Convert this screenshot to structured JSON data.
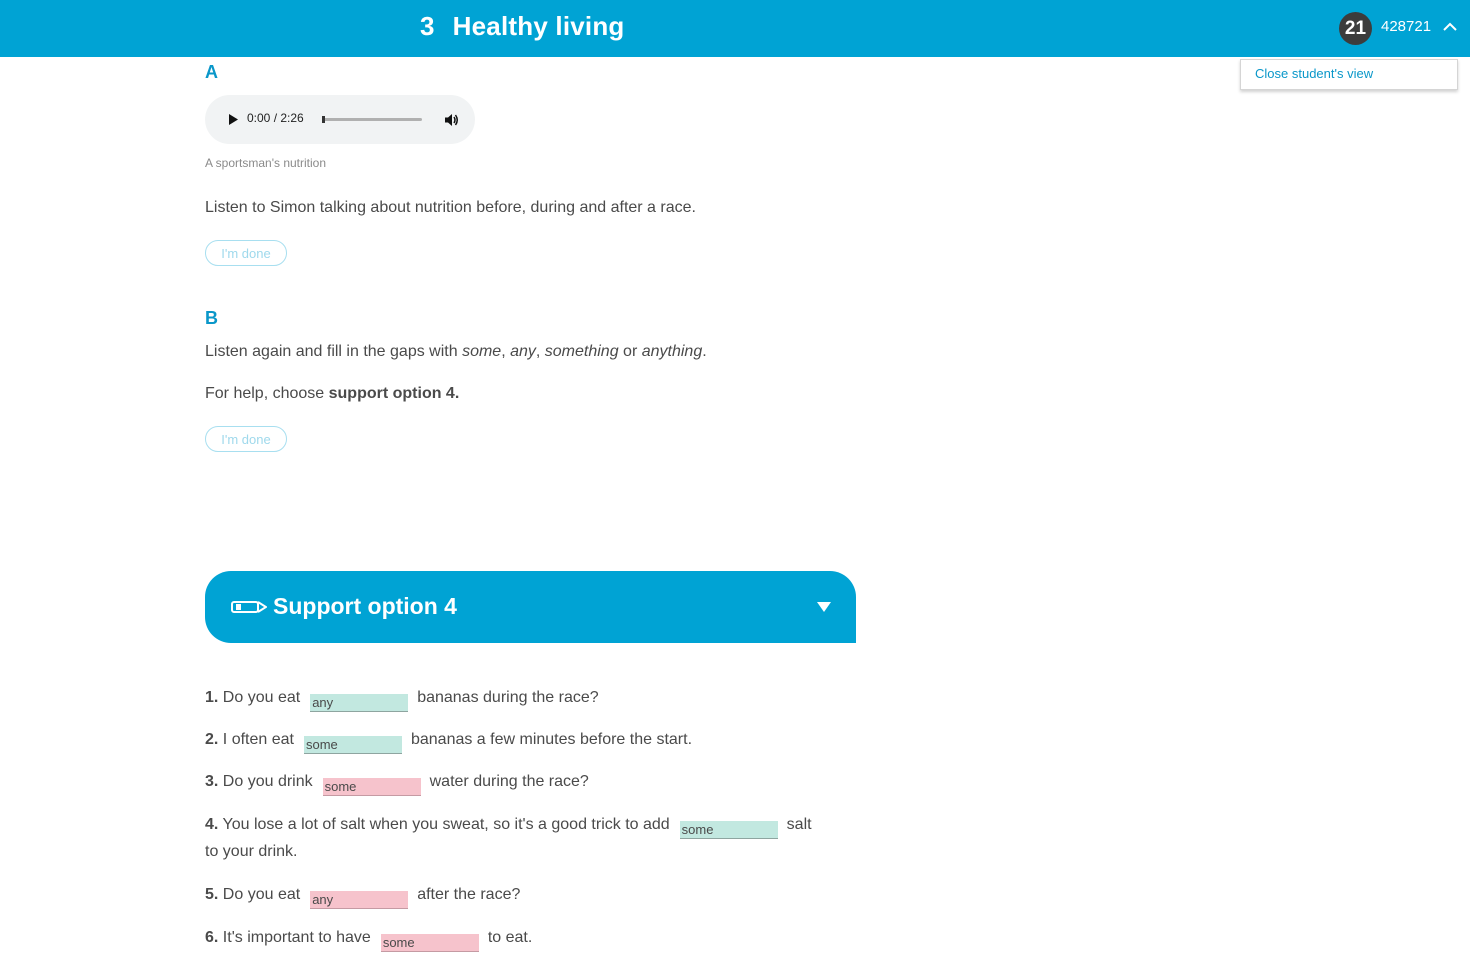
{
  "header": {
    "unit_number": "3",
    "unit_title": "Healthy living",
    "user_number": "21",
    "user_code": "428721",
    "menu_item": "Close student's view"
  },
  "section_a": {
    "letter": "A",
    "audio": {
      "time": "0:00 / 2:26",
      "progress": 0
    },
    "caption": "A sportsman's nutrition",
    "instruction": "Listen to Simon talking about nutrition before, during and after a race.",
    "done_label": "I'm done"
  },
  "section_b": {
    "letter": "B",
    "instruction_start": "Listen again and fill in the gaps with ",
    "word1": "some",
    "sep1": ", ",
    "word2": "any",
    "sep2": ", ",
    "word3": "something",
    "sep3": " or ",
    "word4": "anything",
    "end": ".",
    "help_start": "For help, choose ",
    "help_bold": "support option 4.",
    "done_label": "I'm done"
  },
  "support": {
    "title": "Support option 4"
  },
  "questions": [
    {
      "num": "1.",
      "before": "Do you eat",
      "answer": "any",
      "status": "correct",
      "after": "bananas during the race?"
    },
    {
      "num": "2.",
      "before": "I often eat",
      "answer": "some",
      "status": "correct",
      "after": "bananas a few minutes before the start."
    },
    {
      "num": "3.",
      "before": "Do you drink",
      "answer": "some",
      "status": "incorrect",
      "after": "water during the race?"
    },
    {
      "num": "4.",
      "before": "You lose a lot of salt when you sweat, so it's a good trick to add",
      "answer": "some",
      "status": "correct",
      "after": "salt",
      "continuation": "to your drink."
    },
    {
      "num": "5.",
      "before": "Do you eat",
      "answer": "any",
      "status": "incorrect",
      "after": "after the race?"
    },
    {
      "num": "6.",
      "before": "It's important to have",
      "answer": "some",
      "status": "incorrect",
      "after": "to eat."
    }
  ],
  "colors": {
    "brand_blue": "#00a3d4",
    "correct_fill": "#c2e8e0",
    "incorrect_fill": "#f6c3cc"
  }
}
